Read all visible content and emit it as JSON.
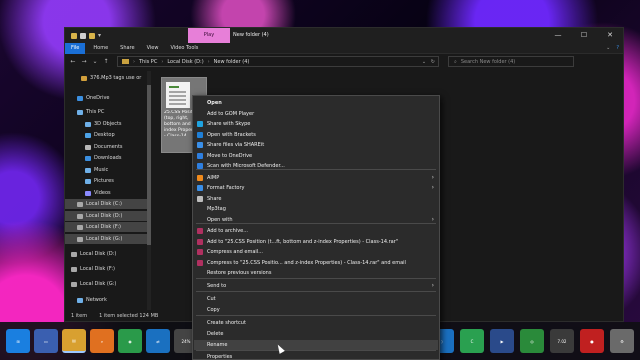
{
  "window": {
    "title": "New folder (4)",
    "contextual_tab": "Play",
    "caption": {
      "minimize": "—",
      "maximize": "☐",
      "close": "✕"
    }
  },
  "ribbon": {
    "tabs": [
      "File",
      "Home",
      "Share",
      "View",
      "Video Tools"
    ],
    "expand": "⌄",
    "help": "?"
  },
  "address": {
    "back": "←",
    "forward": "→",
    "recent": "⌄",
    "up": "↑",
    "crumbs": [
      "This PC",
      "Local Disk (D:)",
      "New folder (4)"
    ],
    "sep": "›",
    "dropdown": "⌄",
    "refresh": "↻",
    "search_placeholder": "Search New folder (4)"
  },
  "sidebar": {
    "items": [
      {
        "label": "376.Mp3 tags use or",
        "icon": "folder-icon",
        "color": "#d2a03c"
      },
      {
        "label": "OneDrive",
        "icon": "cloud-icon",
        "color": "#3b8fe0"
      },
      {
        "label": "This PC",
        "icon": "computer-icon",
        "color": "#6fb0e8"
      },
      {
        "label": "3D Objects",
        "icon": "cube-icon",
        "color": "#6fb0e8"
      },
      {
        "label": "Desktop",
        "icon": "desktop-icon",
        "color": "#4da3e8"
      },
      {
        "label": "Documents",
        "icon": "documents-icon",
        "color": "#b8b8b8"
      },
      {
        "label": "Downloads",
        "icon": "download-icon",
        "color": "#3b8fe0"
      },
      {
        "label": "Music",
        "icon": "music-icon",
        "color": "#6fb0e8"
      },
      {
        "label": "Pictures",
        "icon": "pictures-icon",
        "color": "#6fb0e8"
      },
      {
        "label": "Videos",
        "icon": "videos-icon",
        "color": "#8a8aff"
      },
      {
        "label": "Local Disk (C:)",
        "icon": "drive-icon",
        "color": "#a8a8a8"
      },
      {
        "label": "Local Disk (D:)",
        "icon": "drive-icon",
        "color": "#a8a8a8"
      },
      {
        "label": "Local Disk (F:)",
        "icon": "drive-icon",
        "color": "#a8a8a8"
      },
      {
        "label": "Local Disk (G:)",
        "icon": "drive-icon",
        "color": "#a8a8a8"
      },
      {
        "label": "Local Disk (D:)",
        "icon": "drive-icon",
        "color": "#a8a8a8"
      },
      {
        "label": "Local Disk (F:)",
        "icon": "drive-icon",
        "color": "#a8a8a8"
      },
      {
        "label": "Local Disk (G:)",
        "icon": "drive-icon",
        "color": "#a8a8a8"
      },
      {
        "label": "Network",
        "icon": "network-icon",
        "color": "#6fb0e8"
      }
    ]
  },
  "file": {
    "name": "25.CSS Position (top, right, bottom and z-index Properties) - Class-14"
  },
  "status": {
    "count": "1 item",
    "selected": "1 item selected  124 MB"
  },
  "context_menu": {
    "items": [
      {
        "label": "Open",
        "bold": true
      },
      {
        "label": "Add to GOM Player"
      },
      {
        "label": "Share with Skype",
        "icon": "skype-icon",
        "color": "#1fa3e0"
      },
      {
        "label": "Open with Brackets",
        "icon": "brackets-icon",
        "color": "#1f7fd6"
      },
      {
        "label": "Share files via SHAREit",
        "icon": "shareit-icon",
        "color": "#3a8fe8"
      },
      {
        "label": "Move to OneDrive",
        "icon": "onedrive-icon",
        "color": "#2e7fe0"
      },
      {
        "label": "Scan with Microsoft Defender...",
        "icon": "defender-icon",
        "color": "#2e7fe0"
      },
      {
        "label": "AIMP",
        "icon": "aimp-icon",
        "color": "#f08a1c",
        "submenu": true
      },
      {
        "label": "Format Factory",
        "icon": "format-factory-icon",
        "color": "#3a8fe8",
        "submenu": true
      },
      {
        "label": "Share",
        "icon": "share-icon",
        "color": "#bdbdbd"
      },
      {
        "label": "Mp3tag"
      },
      {
        "label": "Open with",
        "submenu": true
      },
      {
        "label": "Add to archive...",
        "icon": "winrar-icon",
        "color": "#b03060"
      },
      {
        "label": "Add to \"25.CSS Position (t...ft, bottom and z-index Properties) - Class-14.rar\"",
        "icon": "winrar-icon",
        "color": "#b03060"
      },
      {
        "label": "Compress and email...",
        "icon": "winrar-icon",
        "color": "#b03060"
      },
      {
        "label": "Compress to \"25.CSS Positio... and z-index Properties) - Class-14.rar\" and email",
        "icon": "winrar-icon",
        "color": "#b03060"
      },
      {
        "label": "Restore previous versions"
      },
      {
        "label": "Send to",
        "submenu": true
      },
      {
        "label": "Cut"
      },
      {
        "label": "Copy"
      },
      {
        "label": "Create shortcut"
      },
      {
        "label": "Delete"
      },
      {
        "label": "Rename",
        "hover": true
      },
      {
        "label": "Properties"
      }
    ],
    "submenu_arrow": "›"
  },
  "taskbar": {
    "apps": [
      {
        "name": "start-button",
        "color": "#1a7fe0",
        "glyph": "⊞"
      },
      {
        "name": "desktop-app",
        "color": "#3a5fb0",
        "glyph": "▭"
      },
      {
        "name": "files-app",
        "color": "#d8a030",
        "glyph": "▤"
      },
      {
        "name": "search-app",
        "color": "#e07020",
        "glyph": "⌕"
      },
      {
        "name": "camera-app",
        "color": "#2a9a4a",
        "glyph": "◉"
      },
      {
        "name": "teamviewer-app",
        "color": "#1a70c0",
        "glyph": "⇄"
      },
      {
        "name": "cpu-app",
        "color": "#444444",
        "glyph": "24%"
      },
      {
        "name": "alien-app",
        "color": "#c03080",
        "glyph": "☢"
      },
      {
        "name": "globe-app",
        "color": "#3050a0",
        "glyph": "✧"
      }
    ],
    "right_apps": [
      {
        "name": "firefox-app",
        "color": "#3a3a8a",
        "glyph": "◍"
      },
      {
        "name": "vscode-app",
        "color": "#1a6fc0",
        "glyph": "⟩"
      },
      {
        "name": "camtasia-app",
        "color": "#2aa050",
        "glyph": "C"
      },
      {
        "name": "video-app",
        "color": "#2a4a8a",
        "glyph": "▶"
      },
      {
        "name": "chrome-app",
        "color": "#2a8a3a",
        "glyph": "◎"
      },
      {
        "name": "monitor-app",
        "color": "#3a3a3a",
        "glyph": "7.02"
      },
      {
        "name": "recorder-app",
        "color": "#c02020",
        "glyph": "●"
      },
      {
        "name": "settings-app",
        "color": "#6a6a6a",
        "glyph": "⚙"
      }
    ]
  }
}
